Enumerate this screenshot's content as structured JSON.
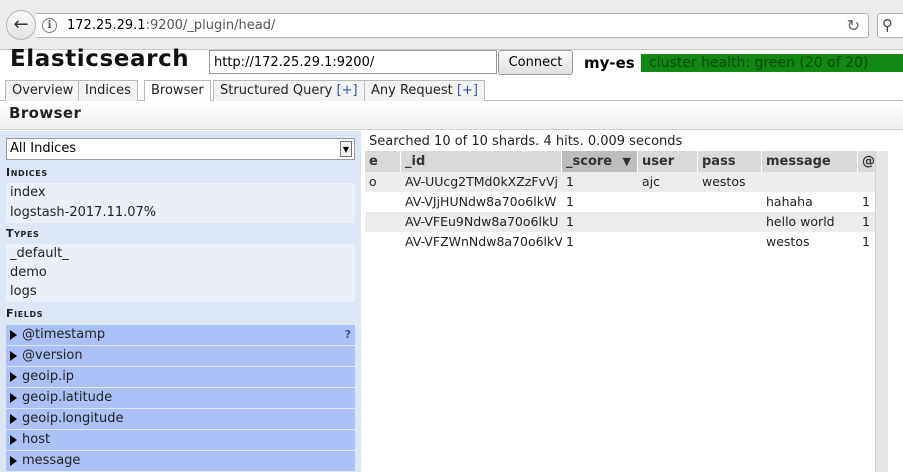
{
  "browser": {
    "url_host": "172.25.29.1",
    "url_path": ":9200/_plugin/head/",
    "back_icon": "back-arrow-icon",
    "reload_icon": "reload-icon"
  },
  "header": {
    "title": "Elasticsearch",
    "connect_url": "http://172.25.29.1:9200/",
    "connect_label": "Connect",
    "cluster_name": "my-es",
    "health_text": "cluster health: green (20 of 20)",
    "health_color": "#118811"
  },
  "tabs": [
    {
      "label": "Overview",
      "plus": ""
    },
    {
      "label": "Indices",
      "plus": ""
    },
    {
      "label": "Browser",
      "plus": ""
    },
    {
      "label": "Structured Query ",
      "plus": "[+]"
    },
    {
      "label": "Any Request ",
      "plus": "[+]"
    }
  ],
  "section_title": "Browser",
  "sidebar": {
    "select_value": "All Indices",
    "indices_heading": "Indices",
    "indices": [
      "index",
      "logstash-2017.11.07%"
    ],
    "types_heading": "Types",
    "types": [
      "_default_",
      "demo",
      "logs"
    ],
    "fields_heading": "Fields",
    "fields": [
      "@timestamp",
      "@version",
      "geoip.ip",
      "geoip.latitude",
      "geoip.longitude",
      "host",
      "message"
    ],
    "field_help": "?"
  },
  "results": {
    "summary": "Searched 10 of 10 shards. 4 hits. 0.009 seconds",
    "columns": [
      "e",
      "_id",
      "_score",
      "user",
      "pass",
      "message",
      "@ve"
    ],
    "sort_icon": "▼",
    "rows": [
      [
        "o",
        "AV-UUcg2TMd0kXZzFvVj",
        "1",
        "ajc",
        "westos",
        "",
        ""
      ],
      [
        "",
        "AV-VJjHUNdw8a70o6lkW",
        "1",
        "",
        "",
        "hahaha",
        "1"
      ],
      [
        "",
        "AV-VFEu9Ndw8a70o6lkU",
        "1",
        "",
        "",
        "hello world",
        "1"
      ],
      [
        "",
        "AV-VFZWnNdw8a70o6lkV",
        "1",
        "",
        "",
        "westos",
        "1"
      ]
    ]
  }
}
